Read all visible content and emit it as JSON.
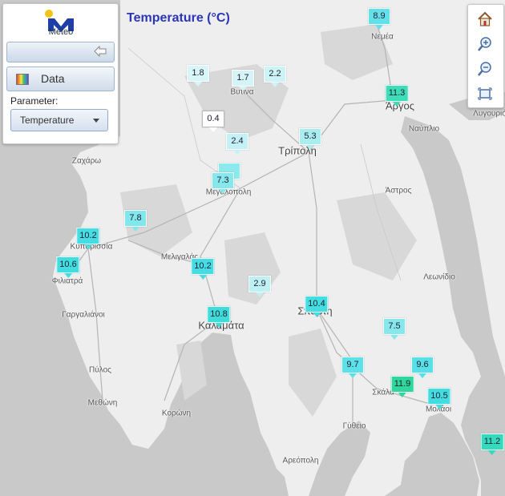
{
  "title": "Temperature (°C)",
  "logo_text": "Meteo",
  "data_button_label": "Data",
  "parameter_label": "Parameter:",
  "parameter_value": "Temperature",
  "icons": {
    "back": "back-arrow-icon",
    "data": "color-scale-icon",
    "home": "home-icon",
    "zoom_in": "zoom-in-icon",
    "zoom_out": "zoom-out-icon",
    "extent": "full-extent-icon"
  },
  "colors": {
    "title": "#2a35b8",
    "marker_low": "#e9f7fb",
    "marker_mid": "#7de6ea",
    "marker_high": "#2fd79d"
  },
  "places": [
    "Νεμέα",
    "Άργος",
    "Ναύπλιο",
    "Λυγουριό",
    "Βυτίνα",
    "Τρίπολη",
    "Ζαχάρω",
    "Μεγαλόπολη",
    "Άστρος",
    "Κυπαρισσία",
    "Μελιγαλάς",
    "Φιλιατρά",
    "Λεωνίδιο",
    "Γαργαλιάνοι",
    "Καλαμάτα",
    "Σπάρτη",
    "Πύλος",
    "Σκάλα",
    "Μεθώνη",
    "Κορώνη",
    "Μολάοι",
    "Γύθειο",
    "Αρεόπολη"
  ],
  "stations": [
    "8.9",
    "11.3",
    "1.8",
    "1.7",
    "2.2",
    "0.4",
    "5.3",
    "2.4",
    "7.3",
    "7.8",
    "10.2",
    "10.6",
    "10.2",
    "2.9",
    "10.4",
    "10.8",
    "7.5",
    "9.7",
    "9.6",
    "11.9",
    "10.5",
    "11.2"
  ]
}
